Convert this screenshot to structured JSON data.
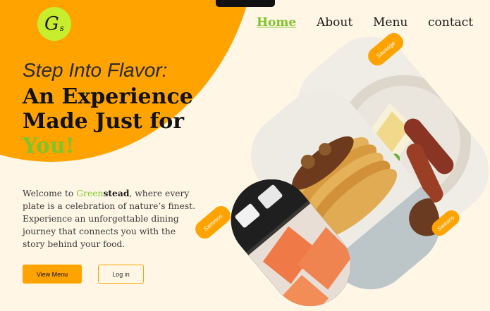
{
  "brand": {
    "logo_letter": "G",
    "logo_subletter": "s"
  },
  "nav": {
    "items": [
      {
        "label": "Home",
        "active": true
      },
      {
        "label": "About",
        "active": false
      },
      {
        "label": "Menu",
        "active": false
      },
      {
        "label": "contact",
        "active": false
      }
    ]
  },
  "hero": {
    "intro": "Step Into Flavor:",
    "line1": "An Experience",
    "line2": "Made Just for",
    "line3": "You!"
  },
  "blurb": {
    "part1": "Welcome to ",
    "green": "Green",
    "bold": "stead",
    "part2": ", where every plate is a celebration of nature’s finest. Experience an unforgettable dining journey that connects you with the story behind your food."
  },
  "buttons": {
    "primary": "View Menu",
    "secondary": "Log in"
  },
  "dishes": {
    "sausage_tag": "Sausage",
    "salmon_tag": "Sammon",
    "pancake_tag": "Sweans"
  },
  "colors": {
    "accent": "#ffa300",
    "green": "#7ec52a",
    "logo_bg": "#c6ee2f",
    "background": "#fff6e6"
  }
}
